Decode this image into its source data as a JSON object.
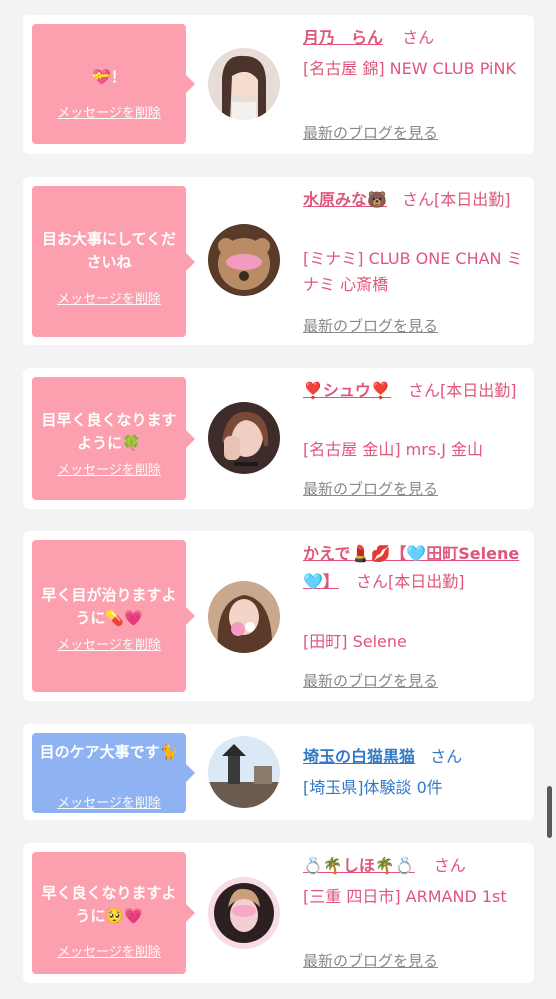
{
  "entries": [
    {
      "message": "💝！",
      "delete_label": "メッセージを削除",
      "name": "月乃　らん",
      "suffix": "さん",
      "shop": "[名古屋 錦] NEW CLUB PiNK",
      "blog_label": "最新のブログを見る",
      "avatar_icon": "profile-photo"
    },
    {
      "message": "目お大事にしてくださいね",
      "delete_label": "メッセージを削除",
      "name": "水原みな🐻",
      "suffix": "さん[本日出勤]",
      "shop": "[ミナミ] CLUB ONE CHAN ミナミ 心斎橋",
      "blog_label": "最新のブログを見る",
      "avatar_icon": "profile-photo"
    },
    {
      "message": "目早く良くなりますように🍀",
      "delete_label": "メッセージを削除",
      "name": "❣️シュウ❣️",
      "suffix": "さん[本日出勤]",
      "shop": "[名古屋 金山] mrs.J 金山",
      "blog_label": "最新のブログを見る",
      "avatar_icon": "profile-photo"
    },
    {
      "message": "早く目が治りますように💊💗",
      "delete_label": "メッセージを削除",
      "name": "かえで💄💋【🩵田町Selene🩵】",
      "suffix": "さん[本日出勤]",
      "shop": "[田町] Selene",
      "blog_label": "最新のブログを見る",
      "avatar_icon": "profile-photo"
    },
    {
      "message": "目のケア大事です🐈",
      "delete_label": "メッセージを削除",
      "name": "埼玉の白猫黒猫",
      "suffix": "さん",
      "shop": "[埼玉県]体験談 0件",
      "blog_label": "",
      "avatar_icon": "profile-photo"
    },
    {
      "message": "早く良くなりますように🥺💗",
      "delete_label": "メッセージを削除",
      "name": "💍🌴しほ🌴💍",
      "suffix": "さん",
      "shop": "[三重 四日市] ARMAND 1st",
      "blog_label": "最新のブログを見る",
      "avatar_icon": "profile-photo"
    }
  ],
  "colors": {
    "page_bg": "#f3f3f5",
    "bubble_pink": "#fca0b0",
    "bubble_blue": "#8fb3f2",
    "name_pink": "#e0567a",
    "name_blue": "#3178c6",
    "blog_gray": "#888888"
  }
}
